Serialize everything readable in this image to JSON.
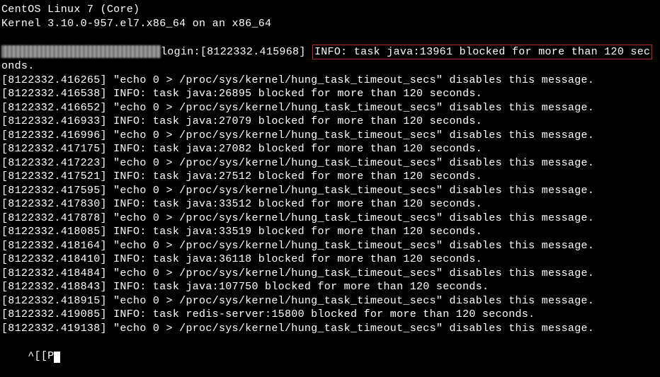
{
  "header": {
    "os_line": "CentOS Linux 7 (Core)",
    "kernel_line": "Kernel 3.10.0-957.el7.x86_64 on an x86_64"
  },
  "login_prompt": " login: ",
  "highlighted_timestamp": "[8122332.415968]",
  "highlighted_message": "INFO: task java:13961 blocked for more than 120 sec",
  "onds_wrap": "onds.",
  "lines": [
    {
      "ts": "[8122332.416265]",
      "msg": "\"echo 0 > /proc/sys/kernel/hung_task_timeout_secs\" disables this message."
    },
    {
      "ts": "[8122332.416538]",
      "msg": "INFO: task java:26895 blocked for more than 120 seconds."
    },
    {
      "ts": "[8122332.416652]",
      "msg": "\"echo 0 > /proc/sys/kernel/hung_task_timeout_secs\" disables this message."
    },
    {
      "ts": "[8122332.416933]",
      "msg": "INFO: task java:27079 blocked for more than 120 seconds."
    },
    {
      "ts": "[8122332.416996]",
      "msg": "\"echo 0 > /proc/sys/kernel/hung_task_timeout_secs\" disables this message."
    },
    {
      "ts": "[8122332.417175]",
      "msg": "INFO: task java:27082 blocked for more than 120 seconds."
    },
    {
      "ts": "[8122332.417223]",
      "msg": "\"echo 0 > /proc/sys/kernel/hung_task_timeout_secs\" disables this message."
    },
    {
      "ts": "[8122332.417521]",
      "msg": "INFO: task java:27512 blocked for more than 120 seconds."
    },
    {
      "ts": "[8122332.417595]",
      "msg": "\"echo 0 > /proc/sys/kernel/hung_task_timeout_secs\" disables this message."
    },
    {
      "ts": "[8122332.417830]",
      "msg": "INFO: task java:33512 blocked for more than 120 seconds."
    },
    {
      "ts": "[8122332.417878]",
      "msg": "\"echo 0 > /proc/sys/kernel/hung_task_timeout_secs\" disables this message."
    },
    {
      "ts": "[8122332.418085]",
      "msg": "INFO: task java:33519 blocked for more than 120 seconds."
    },
    {
      "ts": "[8122332.418164]",
      "msg": "\"echo 0 > /proc/sys/kernel/hung_task_timeout_secs\" disables this message."
    },
    {
      "ts": "[8122332.418410]",
      "msg": "INFO: task java:36118 blocked for more than 120 seconds."
    },
    {
      "ts": "[8122332.418484]",
      "msg": "\"echo 0 > /proc/sys/kernel/hung_task_timeout_secs\" disables this message."
    },
    {
      "ts": "[8122332.418843]",
      "msg": "INFO: task java:107750 blocked for more than 120 seconds."
    },
    {
      "ts": "[8122332.418915]",
      "msg": "\"echo 0 > /proc/sys/kernel/hung_task_timeout_secs\" disables this message."
    },
    {
      "ts": "[8122332.419085]",
      "msg": "INFO: task redis-server:15800 blocked for more than 120 seconds."
    },
    {
      "ts": "[8122332.419138]",
      "msg": "\"echo 0 > /proc/sys/kernel/hung_task_timeout_secs\" disables this message."
    }
  ],
  "input_line": "^[[P"
}
